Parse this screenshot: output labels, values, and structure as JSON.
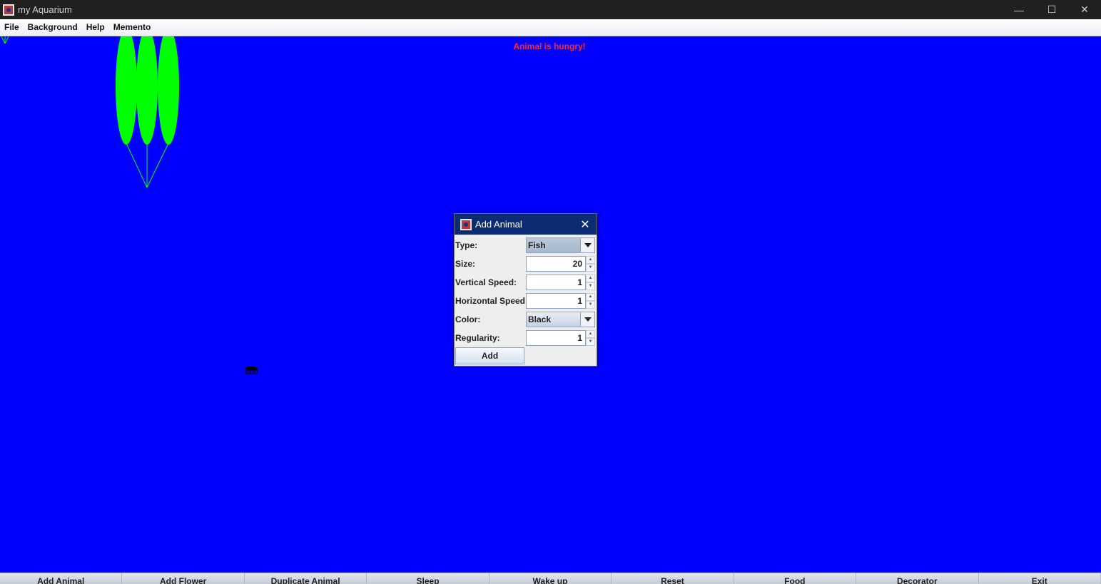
{
  "window": {
    "title": "my Aquarium",
    "controls": {
      "minimize": "—",
      "maximize": "☐",
      "close": "✕"
    }
  },
  "menubar": {
    "items": [
      "File",
      "Background",
      "Help",
      "Memento"
    ]
  },
  "aquarium": {
    "background_color": "#0000ff",
    "status_message": "Animal is hungry!",
    "status_color": "#ff2a2a",
    "plant_color": "#00ff00"
  },
  "dialog": {
    "title": "Add Animal",
    "close": "✕",
    "fields": {
      "type": {
        "label": "Type:",
        "value": "Fish"
      },
      "size": {
        "label": "Size:",
        "value": "20"
      },
      "vertical_speed": {
        "label": "Vertical Speed:",
        "value": "1"
      },
      "horizontal_speed": {
        "label": "Horizontal Speed:",
        "value": "1"
      },
      "color": {
        "label": "Color:",
        "value": "Black"
      },
      "regularity": {
        "label": "Regularity:",
        "value": "1"
      }
    },
    "add_button": "Add"
  },
  "toolbar": {
    "buttons": [
      "Add Animal",
      "Add Flower",
      "Duplicate Animal",
      "Sleep",
      "Wake up",
      "Reset",
      "Food",
      "Decorator",
      "Exit"
    ]
  }
}
